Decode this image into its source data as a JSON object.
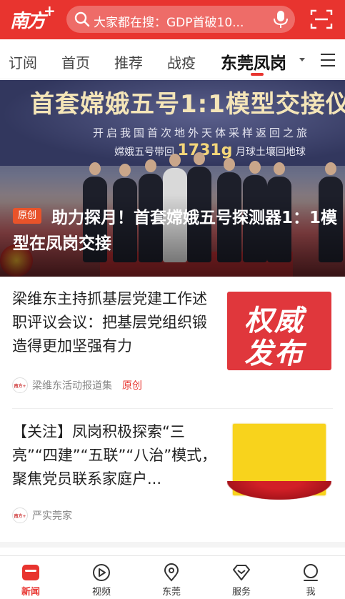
{
  "header": {
    "logo_text": "南方",
    "logo_plus": "+",
    "search_placeholder": "大家都在搜：GDP首破10...",
    "icons": {
      "search": "search-icon",
      "mic": "mic-icon",
      "scan": "scan-icon"
    },
    "color": "#e8342f"
  },
  "tabs": [
    {
      "label": "订阅"
    },
    {
      "label": "首页"
    },
    {
      "label": "推荐"
    },
    {
      "label": "战疫"
    },
    {
      "label": "东莞凤岗",
      "active": true
    }
  ],
  "hero": {
    "banner_headline": "首套嫦娥五号1:1模型交接仪",
    "banner_sub1": "开启我国首次地外天体采样返回之旅",
    "banner_sub2_prefix": "嫦娥五号带回",
    "banner_sub2_value": "1731g",
    "banner_sub2_suffix": "月球土壤回地球",
    "badge": "原创",
    "title": "助力探月！首套嫦娥五号探测器1：1模型在凤岗交接"
  },
  "articles": [
    {
      "title": "梁维东主持抓基层党建工作述职评议会议：把基层党组织锻造得更加坚强有力",
      "thumb_line1": "权威",
      "thumb_line2": "发布",
      "source": "梁维东活动报道集",
      "tag": "原创",
      "avatar_text": "南方+"
    },
    {
      "title": "【关注】凤岗积极探索“三亮”“四建”“五联”“八治”模式，聚焦党员联系家庭户...",
      "source": "严实莞家",
      "avatar_text": "南方+"
    }
  ],
  "bottom_nav": [
    {
      "label": "新闻",
      "icon": "news-icon",
      "active": true
    },
    {
      "label": "视频",
      "icon": "video-icon"
    },
    {
      "label": "东莞",
      "icon": "location-icon"
    },
    {
      "label": "服务",
      "icon": "service-icon"
    },
    {
      "label": "我",
      "icon": "profile-icon"
    }
  ]
}
